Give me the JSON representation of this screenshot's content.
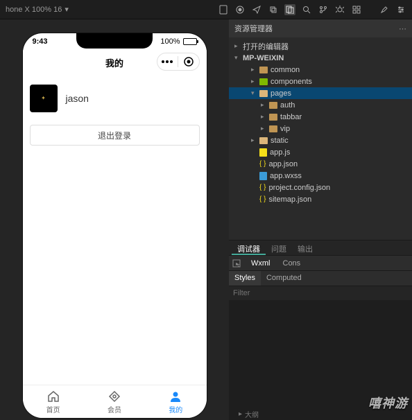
{
  "topbar": {
    "device_label": "hone X 100% 16"
  },
  "simulator": {
    "status_time": "9:43",
    "status_pct": "100%",
    "page_title": "我的",
    "username": "jason",
    "logout_label": "退出登录",
    "tabs": [
      {
        "label": "首页",
        "icon": "home"
      },
      {
        "label": "会员",
        "icon": "vip"
      },
      {
        "label": "我的",
        "icon": "user"
      }
    ]
  },
  "resource": {
    "panel_title": "资源管理器",
    "items": [
      {
        "label": "打开的编辑器",
        "level": 0,
        "arrow": "▸",
        "icon": ""
      },
      {
        "label": "MP-WEIXIN",
        "level": 0,
        "arrow": "▾",
        "icon": "",
        "bold": true
      },
      {
        "label": "common",
        "level": 2,
        "arrow": "▸",
        "icon": "folder-closed"
      },
      {
        "label": "components",
        "level": 2,
        "arrow": "▸",
        "icon": "folder-green"
      },
      {
        "label": "pages",
        "level": 2,
        "arrow": "▾",
        "icon": "folder-open",
        "selected": true
      },
      {
        "label": "auth",
        "level": 3,
        "arrow": "▸",
        "icon": "folder-closed"
      },
      {
        "label": "tabbar",
        "level": 3,
        "arrow": "▸",
        "icon": "folder-closed"
      },
      {
        "label": "vip",
        "level": 3,
        "arrow": "▸",
        "icon": "folder-closed"
      },
      {
        "label": "static",
        "level": 2,
        "arrow": "▸",
        "icon": "folder-open"
      },
      {
        "label": "app.js",
        "level": 2,
        "arrow": "",
        "icon": "file-js"
      },
      {
        "label": "app.json",
        "level": 2,
        "arrow": "",
        "icon": "file-json"
      },
      {
        "label": "app.wxss",
        "level": 2,
        "arrow": "",
        "icon": "file-wxss"
      },
      {
        "label": "project.config.json",
        "level": 2,
        "arrow": "",
        "icon": "file-json"
      },
      {
        "label": "sitemap.json",
        "level": 2,
        "arrow": "",
        "icon": "file-json"
      }
    ]
  },
  "debug": {
    "tabs1": [
      "调试器",
      "问题",
      "输出"
    ],
    "tabs2": [
      "Wxml",
      "Cons"
    ],
    "styles_tabs": [
      "Styles",
      "Computed"
    ],
    "filter_placeholder": "Filter"
  },
  "bottom_strip": "大纲",
  "watermark": "嘻神游"
}
